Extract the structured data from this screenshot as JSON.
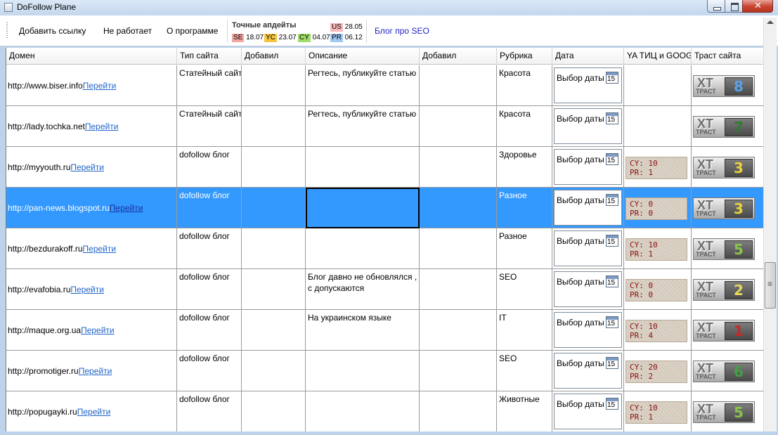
{
  "window": {
    "title": "DoFollow Plane"
  },
  "toolbar": {
    "add_link": "Добавить ссылку",
    "not_working": "Не работает",
    "about": "О программе",
    "updates_title": "Точные апдейты",
    "badges": [
      {
        "code": "SE",
        "date": "18.07",
        "color": "#f4a6a0"
      },
      {
        "code": "YC",
        "date": "23.07",
        "color": "#f5c542"
      },
      {
        "code": "CY",
        "date": "04.07",
        "color": "#9fdc6a"
      },
      {
        "code": "US",
        "date": "28.05",
        "color": "#f7b9b9"
      },
      {
        "code": "PR",
        "date": "06.12",
        "color": "#9fc8f2"
      }
    ],
    "blog_link": "Блог про SEO"
  },
  "columns": [
    "Домен",
    "Тип сайта",
    "Добавил",
    "Описание",
    "Добавил",
    "Рубрика",
    "Дата",
    "YA ТИЦ и GOOG",
    "Траст сайта"
  ],
  "date_label": "Выбор даты",
  "calendar_day": "15",
  "go_label": "Перейти",
  "trust_logo": {
    "xt": "XT",
    "label": "ТРАСТ"
  },
  "rank_labels": {
    "cy": "CY:",
    "pr": "PR:"
  },
  "rows": [
    {
      "domain": "http://www.biser.info",
      "type": "Статейный сайт",
      "description": "Регтесь, публикуйте статью",
      "category": "Красота",
      "cy": null,
      "pr": null,
      "trust": "8",
      "trust_color": "#5aa0e8"
    },
    {
      "domain": "http://lady.tochka.net",
      "type": "Статейный сайт",
      "description": "Регтесь, публикуйте статью",
      "category": "Красота",
      "cy": null,
      "pr": null,
      "trust": "7",
      "trust_color": "#2e7d32"
    },
    {
      "domain": "http://myyouth.ru",
      "type": "dofollow блог",
      "description": "",
      "category": "Здоровье",
      "cy": "10",
      "pr": "1",
      "trust": "3",
      "trust_color": "#e8d23a"
    },
    {
      "domain": "http://pan-news.blogspot.ru",
      "type": "dofollow блог",
      "description": "",
      "category": "Разное",
      "cy": "0",
      "pr": "0",
      "trust": "3",
      "trust_color": "#e8d23a",
      "selected": true
    },
    {
      "domain": "http://bezdurakoff.ru",
      "type": "dofollow блог",
      "description": "",
      "category": "Разное",
      "cy": "10",
      "pr": "1",
      "trust": "5",
      "trust_color": "#8bc34a"
    },
    {
      "domain": "http://evafobia.ru",
      "type": "dofollow блог",
      "description": "Блог давно не обновлялся , с допускаются",
      "category": "SEO",
      "cy": "0",
      "pr": "0",
      "trust": "2",
      "trust_color": "#e6d65a"
    },
    {
      "domain": "http://maque.org.ua",
      "type": "dofollow блог",
      "description": "На украинском языке",
      "category": "IT",
      "cy": "10",
      "pr": "4",
      "trust": "1",
      "trust_color": "#c62828"
    },
    {
      "domain": "http://promotiger.ru",
      "type": "dofollow блог",
      "description": "",
      "category": "SEO",
      "cy": "20",
      "pr": "2",
      "trust": "6",
      "trust_color": "#43a047"
    },
    {
      "domain": "http://popugayki.ru",
      "type": "dofollow блог",
      "description": "",
      "category": "Животные",
      "cy": "10",
      "pr": "1",
      "trust": "5",
      "trust_color": "#8bc34a"
    }
  ]
}
